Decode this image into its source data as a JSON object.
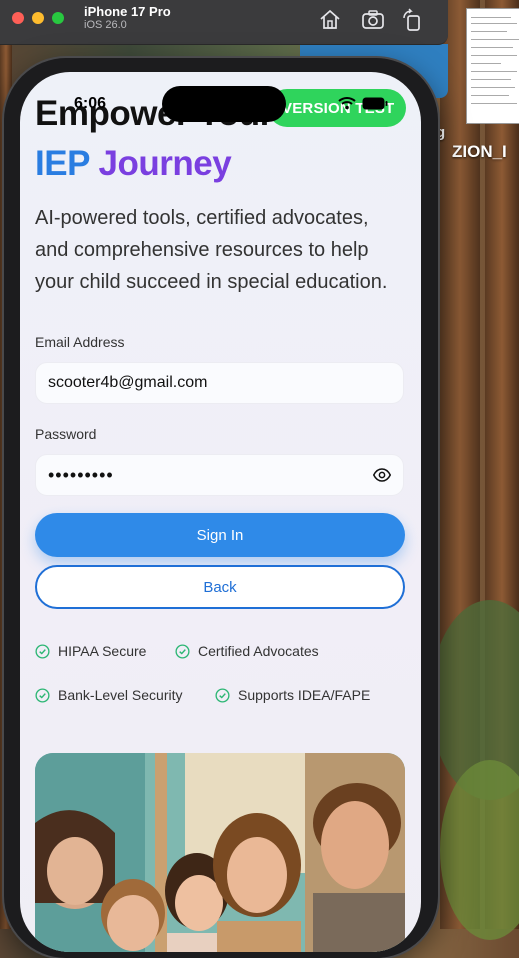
{
  "simulator": {
    "device_name": "iPhone 17 Pro",
    "os_version": "iOS 26.0",
    "icons": [
      "home-icon",
      "screenshot-icon",
      "rotate-icon"
    ]
  },
  "desktop": {
    "file_label_partial": "g",
    "file_label": "ZION_I"
  },
  "status_bar": {
    "time": "6:06",
    "pill_text": "VERSION TEST"
  },
  "hero": {
    "headline_line1": "Empower Your Child's",
    "headline_iep": "IEP",
    "headline_journey": "Journey",
    "tagline": "AI-powered tools, certified advocates, and comprehensive resources to help your child succeed in special education."
  },
  "form": {
    "email_label": "Email Address",
    "email_value": "scooter4b@gmail.com",
    "password_label": "Password",
    "password_value": "•••••••••",
    "sign_in_label": "Sign In",
    "back_label": "Back"
  },
  "features": [
    {
      "label": "HIPAA Secure"
    },
    {
      "label": "Certified Advocates"
    },
    {
      "label": "Bank-Level Security"
    },
    {
      "label": "Supports IDEA/FAPE"
    }
  ],
  "colors": {
    "primary": "#2f8ae8",
    "iep_blue": "#2a7de1",
    "journey_purple": "#7a3fe0",
    "check_green": "#2bb673",
    "pill_green": "#2fd45c"
  }
}
